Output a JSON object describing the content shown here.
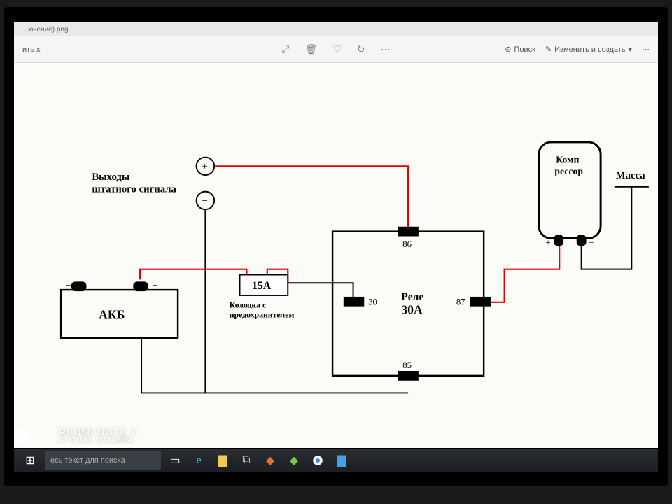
{
  "viewer": {
    "tab": "…ючение).png",
    "back": "ить x",
    "zoom_in": "⤢",
    "delete": "🗑",
    "heart": "♡",
    "rotate": "↻",
    "more": "⋯",
    "search": "Поиск",
    "edit": "Изменить и создать",
    "overflow": "⋯"
  },
  "taskbar": {
    "search_placeholder": "есь текст для поиска"
  },
  "watermark": {
    "line1": "REDMI NOTE 7",
    "line2": "AI DUAL CAMERA"
  },
  "diagram": {
    "battery_label": "АКБ",
    "signal_out_line1": "Выходы",
    "signal_out_line2": "штатного сигнала",
    "plus": "+",
    "minus": "−",
    "fuse_amp": "15А",
    "fuse_cap_line1": "Колодка с",
    "fuse_cap_line2": "предохранителем",
    "relay_line1": "Реле",
    "relay_line2": "30А",
    "pin86": "86",
    "pin85": "85",
    "pin30": "30",
    "pin87": "87",
    "compressor_line1": "Комп",
    "compressor_line2": "рессор",
    "comp_plus": "+",
    "comp_minus": "−",
    "ground": "Масса"
  }
}
